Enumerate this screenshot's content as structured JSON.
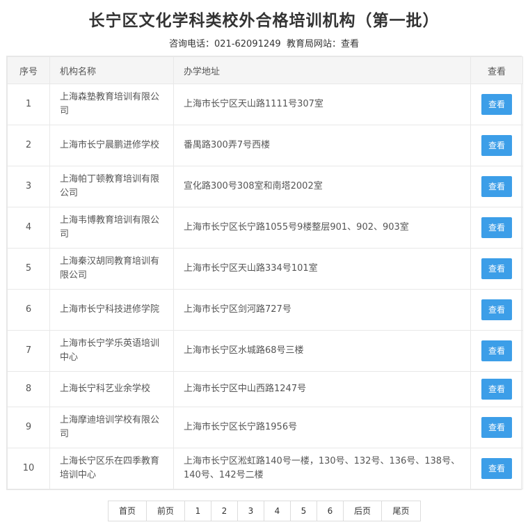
{
  "header": {
    "title": "长宁区文化学科类校外合格培训机构（第一批）",
    "phone_label": "咨询电话：",
    "phone": "021-62091249",
    "site_label": "教育局网站：",
    "site_link": "查看"
  },
  "table": {
    "columns": [
      "序号",
      "机构名称",
      "办学地址",
      "查看"
    ],
    "rows": [
      {
        "no": "1",
        "name": "上海森塾教育培训有限公司",
        "address": "上海市长宁区天山路1111号307室",
        "action": "查看"
      },
      {
        "no": "2",
        "name": "上海市长宁晨鹏进修学校",
        "address": "番禺路300弄7号西楼",
        "action": "查看"
      },
      {
        "no": "3",
        "name": "上海帕丁顿教育培训有限公司",
        "address": "宣化路300号308室和南塔2002室",
        "action": "查看"
      },
      {
        "no": "4",
        "name": "上海韦博教育培训有限公司",
        "address": "上海市长宁区长宁路1055号9楼整层901、902、903室",
        "action": "查看"
      },
      {
        "no": "5",
        "name": "上海秦汉胡同教育培训有限公司",
        "address": "上海市长宁区天山路334号101室",
        "action": "查看"
      },
      {
        "no": "6",
        "name": "上海市长宁科技进修学院",
        "address": "上海市长宁区剑河路727号",
        "action": "查看"
      },
      {
        "no": "7",
        "name": "上海市长宁学乐英语培训中心",
        "address": "上海市长宁区水城路68号三楼",
        "action": "查看"
      },
      {
        "no": "8",
        "name": "上海长宁科艺业余学校",
        "address": "上海市长宁区中山西路1247号",
        "action": "查看"
      },
      {
        "no": "9",
        "name": "上海摩迪培训学校有限公司",
        "address": "上海市长宁区长宁路1956号",
        "action": "查看"
      },
      {
        "no": "10",
        "name": "上海长宁区乐在四季教育培训中心",
        "address": "上海市长宁区淞虹路140号一楼，130号、132号、136号、138号、140号、142号二楼",
        "action": "查看"
      }
    ]
  },
  "pagination": {
    "first": "首页",
    "prev": "前页",
    "pages": [
      "1",
      "2",
      "3",
      "4",
      "5",
      "6"
    ],
    "next": "后页",
    "last": "尾页"
  },
  "colors": {
    "button": "#3c9ee8",
    "header_bg": "#f5f5f5",
    "border": "#e8e8e8"
  }
}
